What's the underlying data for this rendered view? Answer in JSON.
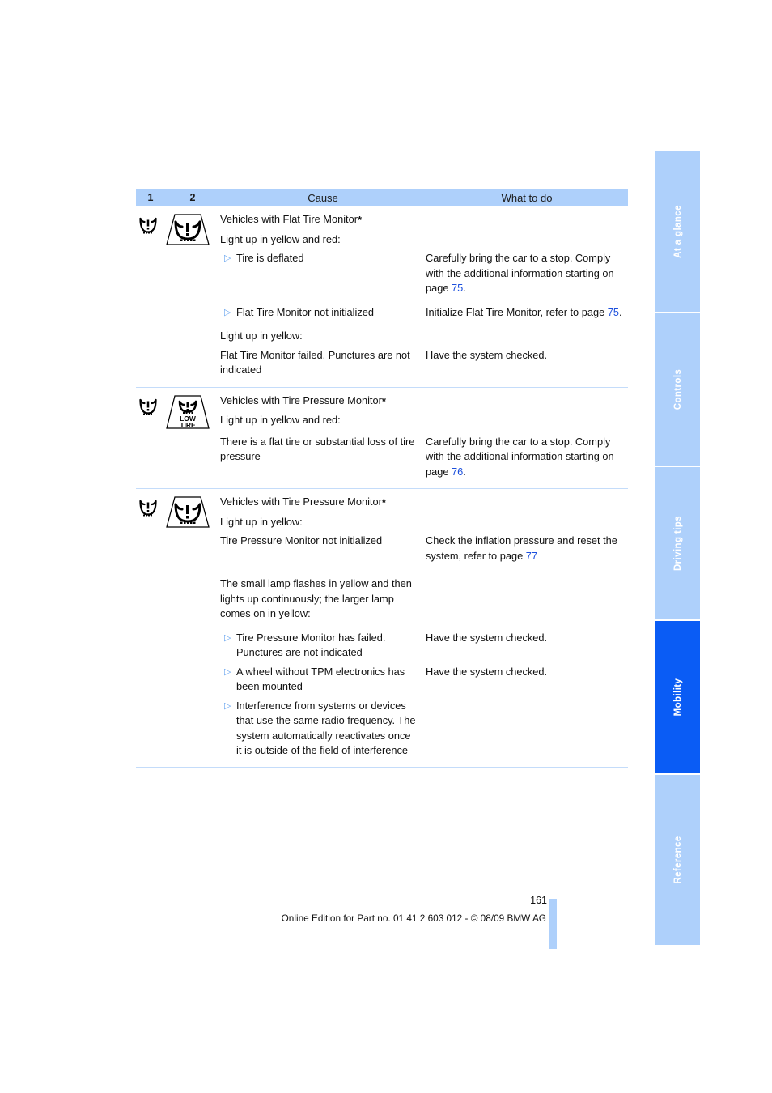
{
  "header": {
    "col1": "1",
    "col2": "2",
    "col3": "Cause",
    "col4": "What to do"
  },
  "sidebar": {
    "tabs": [
      {
        "label": "At a glance",
        "active": false
      },
      {
        "label": "Controls",
        "active": false
      },
      {
        "label": "Driving tips",
        "active": false
      },
      {
        "label": "Mobility",
        "active": true
      },
      {
        "label": "Reference",
        "active": false
      }
    ]
  },
  "sections": [
    {
      "icon1": "tire-pressure-warning-icon",
      "icon2": "tire-pressure-warning-framed-icon",
      "title": "Vehicles with Flat Tire Monitor",
      "title_marker": "*",
      "condition1": "Light up in yellow and red:",
      "bullets": [
        {
          "cause": "Tire is deflated",
          "what_to_do_pre": "Carefully bring the car to a stop. Comply with the additional information starting on page ",
          "what_to_do_page": "75",
          "what_to_do_post": "."
        },
        {
          "cause": "Flat Tire Monitor not initialized",
          "what_to_do_pre": "Initialize Flat Tire Monitor, refer to page ",
          "what_to_do_page": "75",
          "what_to_do_post": "."
        }
      ],
      "condition2": "Light up in yellow:",
      "plain_cause": "Flat Tire Monitor failed. Punctures are not indicated",
      "plain_what_to_do": "Have the system checked."
    },
    {
      "icon1": "tire-pressure-warning-icon",
      "icon2": "low-tire-warning-framed-icon",
      "title": "Vehicles with Tire Pressure Monitor",
      "title_marker": "*",
      "condition1": "Light up in yellow and red:",
      "plain_cause": "There is a flat tire or substantial loss of tire pressure",
      "what_to_do_pre": "Carefully bring the car to a stop. Comply with the additional information starting on page ",
      "what_to_do_page": "76",
      "what_to_do_post": "."
    },
    {
      "icon1": "tire-pressure-warning-icon",
      "icon2": "tire-pressure-warning-framed-icon",
      "title": "Vehicles with Tire Pressure Monitor",
      "title_marker": "*",
      "condition1": "Light up in yellow:",
      "cause_a": "Tire Pressure Monitor not initialized",
      "what_to_do_a_pre": "Check the inflation pressure and reset the system, refer to page ",
      "what_to_do_a_page": "77",
      "what_to_do_a_post": "",
      "condition2": "The small lamp flashes in yellow and then lights up continuously; the larger lamp comes on in yellow:",
      "bullets": [
        {
          "cause": "Tire Pressure Monitor has failed. Punctures are not indicated",
          "what_to_do": "Have the system checked."
        },
        {
          "cause": "A wheel without TPM electronics has been mounted",
          "what_to_do": "Have the system checked."
        },
        {
          "cause": "Interference from systems or devices that use the same radio frequency. The system automatically reactivates once it is outside of the field of interference",
          "what_to_do": ""
        }
      ]
    }
  ],
  "footer": {
    "page_number": "161",
    "edition_line": "Online Edition for Part no. 01 41 2 603 012 - © 08/09 BMW AG"
  },
  "colors": {
    "band": "#aed0fb",
    "active_tab": "#0a5cf5",
    "link": "#1b4fdd",
    "rule": "#c4dcfa"
  }
}
